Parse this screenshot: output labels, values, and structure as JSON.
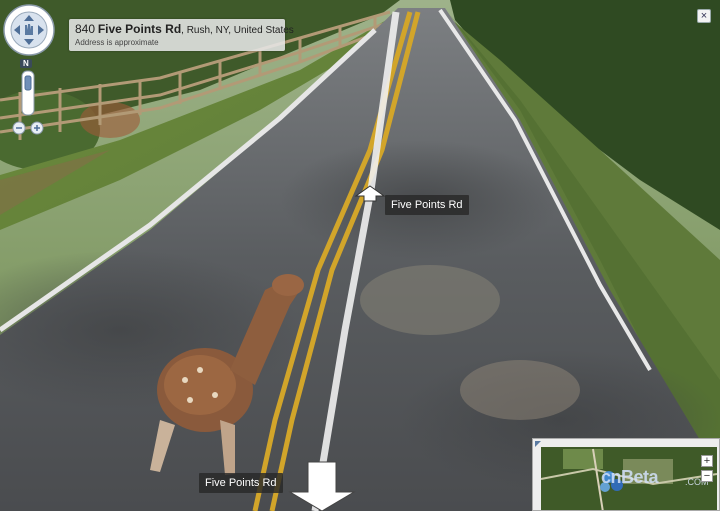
{
  "address": {
    "number": "840",
    "street": "Five Points Rd",
    "locality": ", Rush, NY, United States",
    "note": "Address is approximate"
  },
  "labels": {
    "street_forward": "Five Points Rd",
    "street_back": "Five Points Rd",
    "compass_north": "N",
    "close": "×"
  },
  "minimap": {
    "zoom_in": "+",
    "zoom_out": "−",
    "watermark": "cnBeta",
    "watermark_suffix": ".COM"
  }
}
